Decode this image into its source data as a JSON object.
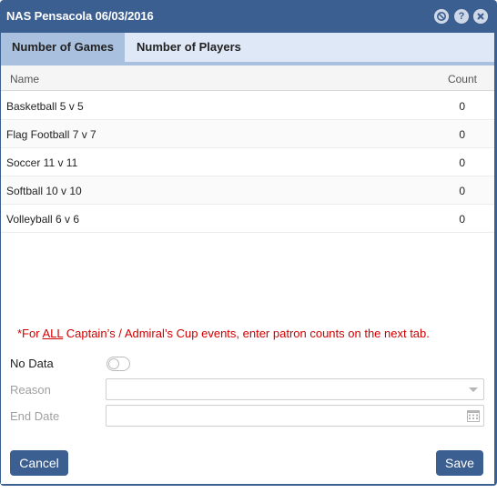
{
  "window": {
    "title": "NAS Pensacola 06/03/2016"
  },
  "tabs": [
    {
      "label": "Number of Games"
    },
    {
      "label": "Number of Players"
    }
  ],
  "grid": {
    "columns": {
      "name": "Name",
      "count": "Count"
    },
    "rows": [
      {
        "name": "Basketball 5 v 5",
        "count": "0"
      },
      {
        "name": "Flag Football 7 v 7",
        "count": "0"
      },
      {
        "name": "Soccer 11 v 11",
        "count": "0"
      },
      {
        "name": "Softball 10 v 10",
        "count": "0"
      },
      {
        "name": "Volleyball 6 v 6",
        "count": "0"
      }
    ]
  },
  "notice": {
    "prefix": "*For ",
    "emphasis": "ALL",
    "suffix": " Captain’s / Admiral’s Cup events, enter patron counts on the next tab."
  },
  "form": {
    "no_data_label": "No Data",
    "no_data_value": false,
    "reason_label": "Reason",
    "reason_value": "",
    "end_date_label": "End Date",
    "end_date_value": ""
  },
  "buttons": {
    "cancel": "Cancel",
    "save": "Save"
  },
  "colors": {
    "header": "#3c5f92",
    "tab_active": "#a9c0de",
    "tab_bar": "#dfe8f6",
    "notice": "#d00000"
  }
}
